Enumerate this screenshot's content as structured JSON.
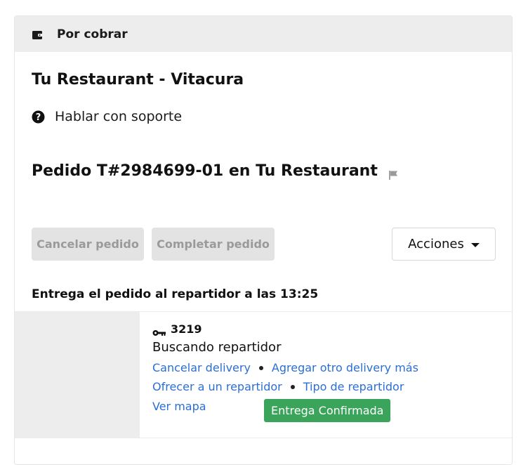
{
  "header": {
    "title": "Por cobrar",
    "icon": "wallet-icon"
  },
  "restaurant": {
    "name": "Tu Restaurant - Vitacura"
  },
  "support": {
    "label": "Hablar con soporte",
    "icon": "question-circle-icon"
  },
  "order": {
    "title": "Pedido T#2984699-01 en Tu Restaurant",
    "flag_icon": "flag-icon"
  },
  "buttons": {
    "cancel": "Cancelar pedido",
    "complete": "Completar pedido",
    "actions": "Acciones"
  },
  "delivery_time_text": "Entrega el pedido al repartidor a las 13:25",
  "delivery": {
    "code": "3219",
    "code_icon": "key-icon",
    "status": "Buscando repartidor",
    "links": {
      "cancel_delivery": "Cancelar delivery",
      "add_delivery": "Agregar otro delivery más",
      "offer_rider": "Ofrecer a un repartidor",
      "rider_type": "Tipo de repartidor",
      "view_map": "Ver mapa"
    },
    "badge": "Entrega Confirmada"
  },
  "colors": {
    "link": "#2a6fd6",
    "badge": "#3aa55a",
    "header_bg": "#ededed",
    "disabled_bg": "#e3e3e3"
  }
}
